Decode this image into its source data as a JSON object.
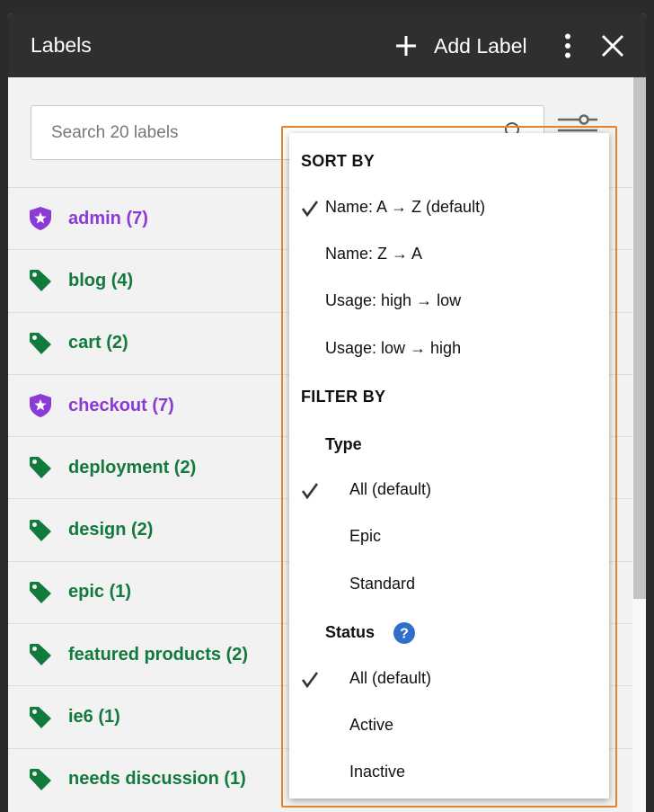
{
  "header": {
    "title": "Labels",
    "add_label": "Add Label"
  },
  "search": {
    "placeholder": "Search 20 labels"
  },
  "labels": [
    {
      "name": "admin (7)",
      "type": "epic"
    },
    {
      "name": "blog (4)",
      "type": "standard"
    },
    {
      "name": "cart (2)",
      "type": "standard"
    },
    {
      "name": "checkout (7)",
      "type": "epic"
    },
    {
      "name": "deployment (2)",
      "type": "standard"
    },
    {
      "name": "design (2)",
      "type": "standard"
    },
    {
      "name": "epic (1)",
      "type": "standard"
    },
    {
      "name": "featured products (2)",
      "type": "standard"
    },
    {
      "name": "ie6 (1)",
      "type": "standard"
    },
    {
      "name": "needs discussion (1)",
      "type": "standard"
    }
  ],
  "dropdown": {
    "sort_heading": "SORT BY",
    "sort_options": [
      {
        "label": "Name: A → Z (default)",
        "checked": true
      },
      {
        "label": "Name: Z → A",
        "checked": false
      },
      {
        "label": "Usage: high → low",
        "checked": false
      },
      {
        "label": "Usage: low → high",
        "checked": false
      }
    ],
    "filter_heading": "FILTER BY",
    "type_heading": "Type",
    "type_options": [
      {
        "label": "All (default)",
        "checked": true
      },
      {
        "label": "Epic",
        "checked": false
      },
      {
        "label": "Standard",
        "checked": false
      }
    ],
    "status_heading": "Status",
    "status_options": [
      {
        "label": "All (default)",
        "checked": true
      },
      {
        "label": "Active",
        "checked": false
      },
      {
        "label": "Inactive",
        "checked": false
      }
    ]
  },
  "colors": {
    "epic": "#8b3ad3",
    "standard": "#127a3c",
    "highlight": "#e8832a",
    "help": "#2f6fc9"
  },
  "icons": {
    "epic": "shield-star-icon",
    "standard": "tag-icon"
  }
}
